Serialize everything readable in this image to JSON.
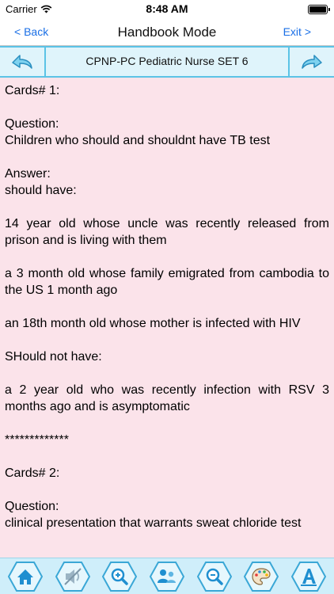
{
  "status_bar": {
    "carrier": "Carrier",
    "time": "8:48 AM"
  },
  "nav": {
    "back_label": "< Back",
    "title": "Handbook Mode",
    "exit_label": "Exit >"
  },
  "toolbar": {
    "set_title": "CPNP-PC Pediatric Nurse SET 6"
  },
  "cards": [
    {
      "heading": "Cards# 1:",
      "question_label": "Question:",
      "question": "Children who should and shouldnt have TB test",
      "answer_label": "Answer:",
      "answer_lines": [
        "should have:",
        "14 year old whose uncle was recently released from prison and is living with them",
        "a 3 month old whose family emigrated from cambodia to the US 1 month ago",
        "an 18th month old whose mother is infected with HIV",
        "SHould not have:",
        "a 2 year old who was recently infection with RSV 3 months ago and is asymptomatic",
        "*************"
      ]
    },
    {
      "heading": "Cards# 2:",
      "question_label": "Question:",
      "question": "clinical presentation that warrants sweat chloride test"
    }
  ],
  "bottom_toolbar": {
    "icons": [
      "home-icon",
      "audio-off-icon",
      "zoom-in-icon",
      "share-icon",
      "zoom-out-icon",
      "palette-icon",
      "font-style-icon"
    ]
  },
  "colors": {
    "accent_blue": "#1a6fe6",
    "toolbar_border": "#5bc3e6",
    "toolbar_bg": "#dff4fb",
    "content_bg": "#fbe3ea",
    "bottom_bar_bg": "#cfeefa"
  }
}
